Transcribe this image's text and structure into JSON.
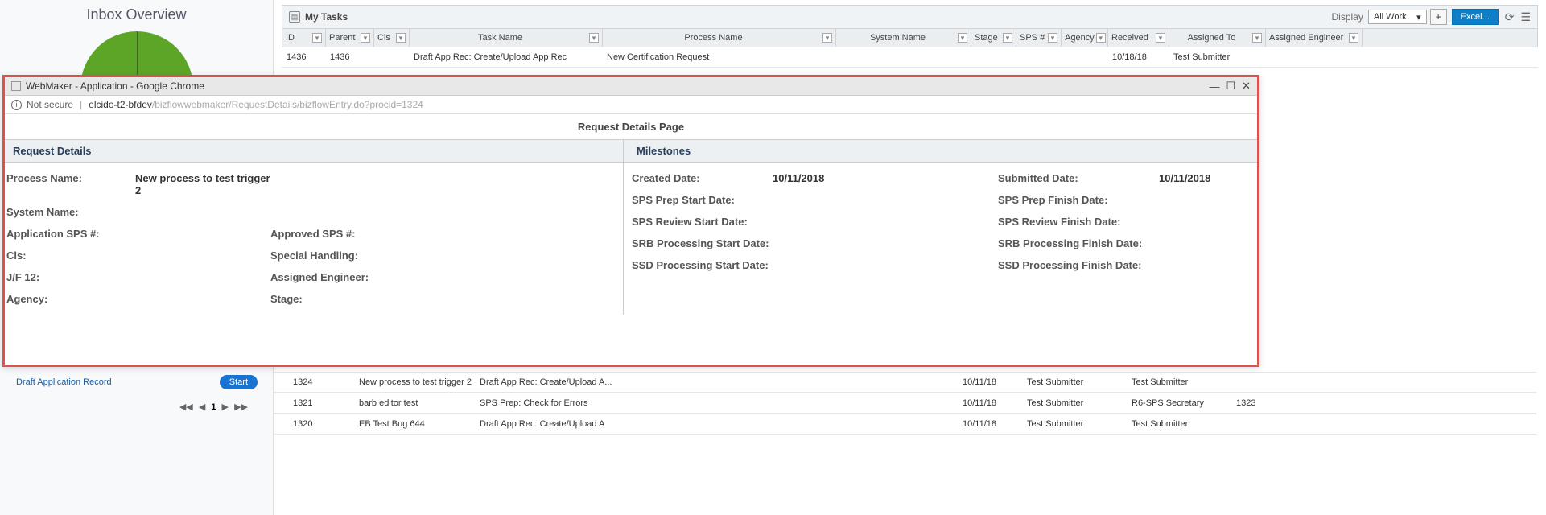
{
  "sidebar": {
    "title": "Inbox Overview",
    "draft_link": "Draft Application Record",
    "start_btn": "Start",
    "pagination_page": "1"
  },
  "panel": {
    "title": "My Tasks",
    "display_label": "Display",
    "display_value": "All Work",
    "excel_btn": "Excel..."
  },
  "columns": {
    "id": "ID",
    "parent": "Parent",
    "cls": "Cls",
    "task": "Task Name",
    "process": "Process Name",
    "system": "System Name",
    "stage": "Stage",
    "sps": "SPS #",
    "agency": "Agency",
    "received": "Received",
    "assigned": "Assigned To",
    "engineer": "Assigned Engineer"
  },
  "rows_top": [
    {
      "id": "1436",
      "parent": "1436",
      "cls": "",
      "task": "Draft App Rec: Create/Upload App Rec",
      "process": "New Certification Request",
      "system": "",
      "stage": "",
      "sps": "",
      "agency": "",
      "received": "10/18/18",
      "assigned": "Test Submitter",
      "engineer": ""
    }
  ],
  "rows_bottom": [
    {
      "id": "1324",
      "parent": "",
      "cls": "",
      "task": "New process to test trigger 2",
      "process": "Draft App Rec: Create/Upload A...",
      "system": "",
      "received": "10/11/18",
      "assigned": "Test Submitter",
      "engineer": "Test Submitter",
      "end": ""
    },
    {
      "id": "1321",
      "parent": "",
      "cls": "",
      "task": "barb editor test",
      "process": "SPS Prep: Check for Errors",
      "system": "",
      "received": "10/11/18",
      "assigned": "Test Submitter",
      "engineer": "R6-SPS Secretary",
      "end": "1323"
    },
    {
      "id": "1320",
      "parent": "",
      "cls": "",
      "task": "EB Test Bug 644",
      "process": "Draft App Rec: Create/Upload A",
      "system": "",
      "received": "10/11/18",
      "assigned": "Test Submitter",
      "engineer": "Test Submitter",
      "end": ""
    }
  ],
  "popup": {
    "window_title": "WebMaker - Application - Google Chrome",
    "not_secure": "Not secure",
    "url_dark": "elcido-t2-bfdev",
    "url_light": "/bizflowwebmaker/RequestDetails/bizflowEntry.do?procid=1324",
    "page_title": "Request Details Page",
    "left_header": "Request Details",
    "right_header": "Milestones",
    "left_fields": [
      {
        "l1": "Process Name:",
        "v1": "New process to test trigger 2",
        "l2": "",
        "v2": ""
      },
      {
        "l1": "System Name:",
        "v1": "",
        "l2": "",
        "v2": ""
      },
      {
        "l1": "Application SPS #:",
        "v1": "",
        "l2": "Approved SPS #:",
        "v2": ""
      },
      {
        "l1": "Cls:",
        "v1": "",
        "l2": "Special Handling:",
        "v2": ""
      },
      {
        "l1": "J/F 12:",
        "v1": "",
        "l2": "Assigned Engineer:",
        "v2": ""
      },
      {
        "l1": "Agency:",
        "v1": "",
        "l2": "Stage:",
        "v2": ""
      }
    ],
    "right_fields": [
      {
        "l1": "Created Date:",
        "v1": "10/11/2018",
        "l2": "Submitted Date:",
        "v2": "10/11/2018"
      },
      {
        "l1": "SPS Prep Start Date:",
        "v1": "",
        "l2": "SPS Prep Finish Date:",
        "v2": ""
      },
      {
        "l1": "SPS Review Start Date:",
        "v1": "",
        "l2": "SPS Review Finish Date:",
        "v2": ""
      },
      {
        "l1": "SRB Processing Start Date:",
        "v1": "",
        "l2": "SRB Processing Finish Date:",
        "v2": ""
      },
      {
        "l1": "SSD Processing Start Date:",
        "v1": "",
        "l2": "SSD Processing Finish Date:",
        "v2": ""
      }
    ]
  }
}
